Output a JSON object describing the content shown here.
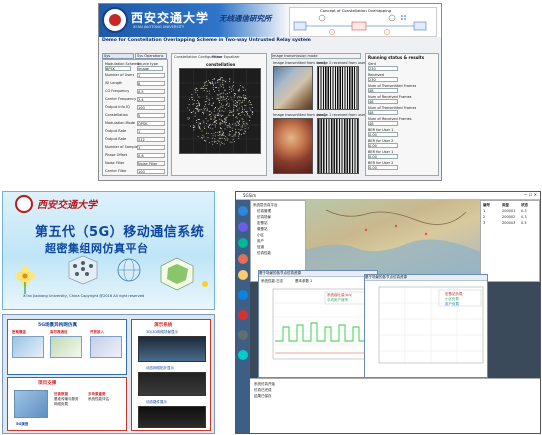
{
  "top": {
    "university_cn": "西安交通大学",
    "university_en": "XI'AN JIAOTONG UNIVERSITY",
    "lab": "无线通信研究所",
    "diagram_title": "Concept of Constellation Overlapping",
    "demo_title": "Demo for Constellation Overlapping Scheme in Two-way Untrusted Relay system",
    "controls": {
      "tab1": "Sys Configuration",
      "tab2": "Sys Operations",
      "modulation_label": "Modulation Scheme",
      "modulation_value": "BPSK",
      "source_label": "Source type",
      "source_value": "Image",
      "field_labels": [
        "Number of Users",
        "ISI Length",
        "CG Frequency",
        "Carrier Frequency",
        "Output Info IQ",
        "Constellation",
        "Modulation Mode",
        "Output Rate",
        "Output Rate",
        "Number of Samples",
        "Phase Offset",
        "Noise Filter",
        "Carrier Filter",
        "Filter Bandwidth",
        "Filter Frequency",
        "Filter Frequency"
      ],
      "field_values": [
        "1",
        "8",
        "0.5",
        "2.4",
        "100",
        "5",
        "QPSK",
        "1",
        "512",
        "1",
        "0.6",
        "Noise Filter",
        "100"
      ]
    },
    "const_tabs": [
      "Constellation Configuration",
      "Phase Equalizer",
      "Carrier Offset",
      "Bit-By-Bit",
      "Bit-By-Bit"
    ],
    "const_title": "constellation",
    "img_tabs": [
      "Audio transmission mode",
      "Image transmission mode",
      "Data transmission mode"
    ],
    "img_labels": [
      "Image transmitted from user1",
      "Image 2 received from user1",
      "Image transmitted from user2",
      "Image 1 received from user2"
    ],
    "results": {
      "title": "Running status & results",
      "items": [
        "Sent",
        "Received",
        "Num of Transmitted Frames",
        "Num of Received Frames",
        "Num of Transmitted Frames",
        "Num of Received Frames",
        "BER for User 1",
        "BER for User 2",
        "BER for User 1",
        "BER for User 2"
      ],
      "values": [
        "230",
        "230",
        "48",
        "48",
        "48",
        "48",
        "0.00",
        "0.00",
        "0.00",
        "0.00"
      ]
    }
  },
  "fiveg_cover": {
    "university_cn": "西安交通大学",
    "title_line1": "第五代（5G）移动通信系统",
    "title_line2": "超密集组网仿真平台",
    "copyright": "Xi'an Jiaotong University, China  Copyright @2016 All right reserved"
  },
  "fiveg_arch": {
    "section1": "5G场景异构网仿真",
    "section2": "演示系统",
    "section3": "项目支撑",
    "items": [
      "密集覆盖",
      "高可靠通信",
      "开放接入",
      "3D/3D网络场景显示",
      "动态网络拓扑显示",
      "仿真数据",
      "基准传输与服务",
      "网络负载",
      "多场景重要",
      "系统性能评估",
      "5G演进",
      "动态路件展示"
    ]
  },
  "app": {
    "title": "5GSim",
    "tree_items": [
      "系统层仿真平台",
      "仿真管理",
      "仿真场景",
      "宏基站",
      "微基站",
      "小区",
      "用户",
      "信道",
      "仿真性能"
    ],
    "win1_title": "基于场景的各节点仿真资源",
    "win1_tabs": [
      "系统性能-日志",
      "基本参数 1",
      "OR4",
      "OR4"
    ],
    "win1_legend": [
      "系统吞吐量(b/s)",
      "平均用户速率"
    ],
    "win2_title": "基于场景的各节点仿真资源",
    "win2_legend": [
      "宏基站负载",
      "小区负载",
      "用户负载"
    ],
    "table_headers": [
      "编号",
      "类型",
      "状态"
    ],
    "table_rows": [
      [
        "1",
        "200001",
        "0.3"
      ],
      [
        "2",
        "200002",
        "0.3"
      ],
      [
        "3",
        "200003",
        "0.5"
      ]
    ],
    "log_lines": [
      "系统仿真开始",
      "仿真已完成",
      "结果已保存"
    ]
  }
}
